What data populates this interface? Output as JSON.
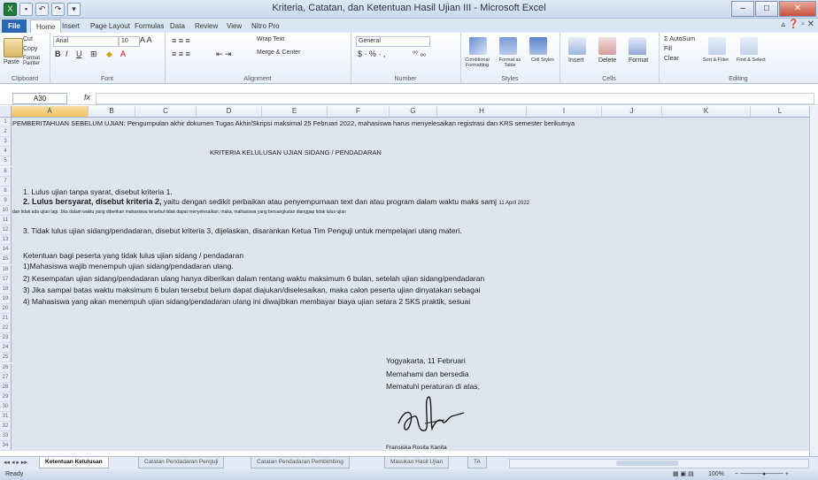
{
  "window": {
    "title": "Kriteria, Catatan, dan Ketentuan Hasil Ujian III - Microsoft Excel"
  },
  "ribbon": {
    "tabs": [
      "File",
      "Home",
      "Insert",
      "Page Layout",
      "Formulas",
      "Data",
      "Review",
      "View",
      "Nitro Pro"
    ],
    "active_tab": "Home",
    "clipboard": {
      "cut": "Cut",
      "copy": "Copy",
      "paste": "Paste",
      "format_painter": "Format Painter",
      "label": "Clipboard"
    },
    "font": {
      "name": "Arial",
      "size": "10",
      "label": "Font"
    },
    "alignment": {
      "wrap": "Wrap Text",
      "merge": "Merge & Center",
      "label": "Alignment"
    },
    "number": {
      "format": "General",
      "label": "Number"
    },
    "styles": {
      "conditional": "Conditional Formatting",
      "format_table": "Format as Table",
      "cell_styles": "Cell Styles",
      "label": "Styles"
    },
    "cells": {
      "insert": "Insert",
      "delete": "Delete",
      "format": "Format",
      "label": "Cells"
    },
    "editing": {
      "autosum": "AutoSum",
      "fill": "Fill",
      "clear": "Clear",
      "sort": "Sort & Filter",
      "find": "Find & Select",
      "label": "Editing"
    }
  },
  "formula_bar": {
    "name_box": "A30",
    "fx": "fx",
    "value": ""
  },
  "columns": [
    "A",
    "B",
    "C",
    "D",
    "E",
    "F",
    "G",
    "H",
    "I",
    "J",
    "K",
    "L"
  ],
  "selected_column": "A",
  "rows": [
    "1",
    "2",
    "3",
    "4",
    "5",
    "6",
    "7",
    "8",
    "9",
    "10",
    "11",
    "12",
    "13",
    "14",
    "15",
    "16",
    "17",
    "18",
    "19",
    "20",
    "21",
    "22",
    "23",
    "24",
    "25",
    "26",
    "27",
    "28",
    "29",
    "30",
    "31",
    "32",
    "33",
    "34"
  ],
  "cells": {
    "r1": "PEMBERITAHUAN SEBELUM UJIAN: Pengumpulan akhir dokumen Tugas Akhir/Skripsi maksimal 25 Februari 2022, mahasiswa harus menyelesaikan registrasi dan KRS semester berikutnya",
    "r4": "KRITERIA KELULUSAN UJIAN SIDANG / PENDADARAN",
    "r7": "1. Lulus ujian tanpa syarat, disebut kriteria 1.",
    "r8_bold": "2. Lulus bersyarat, disebut kriteria 2,",
    "r8_rest": " yaitu dengan sedikit perbaikan atau penyempurnaan text dan atau program dalam waktu maks samj",
    "r8_date": "11 April 2022",
    "r9": "dan tidak ada ujian lagi. Jika dalam waktu yang diberikan mahasiswa tersebut tidak dapat menyelesaikan, maka, mahasiswa yang bersangkutan dianggap tidak lulus ujian",
    "r10": "3. Tidak lulus ujian sidang/pendadaran, disebut kriteria 3, dijelaskan, disarankan Ketua Tim Penguji untuk mempelajari ulang materi.",
    "r12": "Ketentuan bagi peserta yang tidak lulus ujian sidang / pendadaran",
    "r13": "1)Mahasiswa wajib menempuh ujian sidang/pendadaran ulang.",
    "r14": "2) Kesempatan ujian sidang/pendadaran ulang hanya diberikan dalam rentang waktu maksimum 6 bulan, setelah ujian sidang/pendadaran",
    "r15": "3) Jika sampai batas waktu maksimum 6 bulan tersebut belum dapat diajukan/diselesaikan, maka calon peserta ujian dinyatakan sebagai",
    "r16": "4) Mahasiswa yang akan menempuh ujian sidang/pendadaran ulang ini diwajibkan membayar biaya ujian setara 2 SKS praktik, sesuai",
    "sign_place": "Yogyakarta, 11 Februari",
    "sign_line1": "Memahami dan bersedia",
    "sign_line2": "Mematuhi peraturan di atas,",
    "sign_name": "Fransiska Rosita Kanita"
  },
  "sheet_tabs": [
    "Ketentuan Kelulusan",
    "Catatan Pendadaran Penguji",
    "Catatan Pendadaran Pembimbing",
    "Masukan Hasil Ujian",
    "TA"
  ],
  "active_sheet": "Ketentuan Kelulusan",
  "status": {
    "ready": "Ready",
    "zoom": "100%"
  }
}
